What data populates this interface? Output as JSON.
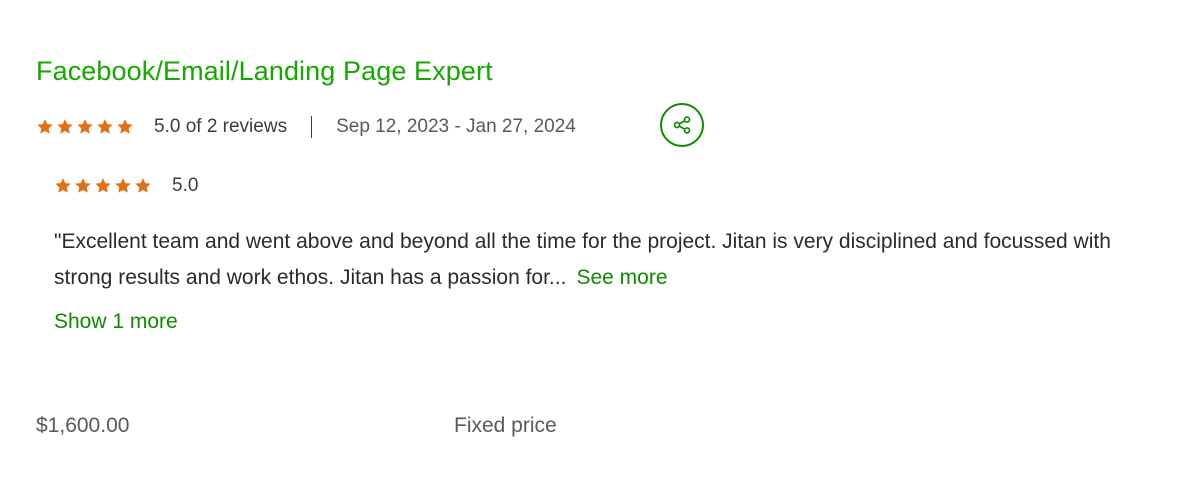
{
  "job": {
    "title": "Facebook/Email/Landing Page Expert",
    "overall_rating_text": "5.0 of 2 reviews",
    "star_count": 5,
    "date_range": "Sep 12, 2023 - Jan 27, 2024",
    "share_icon": "share-icon"
  },
  "review": {
    "score": "5.0",
    "star_count": 5,
    "text": "\"Excellent team and went above and beyond all the time for the project. Jitan is very disciplined and focussed with strong results and work ethos. Jitan has a passion for...",
    "see_more_label": "See more",
    "show_more_label": "Show 1 more"
  },
  "pricing": {
    "amount": "$1,600.00",
    "type": "Fixed price"
  },
  "colors": {
    "accent_green": "#14a800",
    "link_green": "#108a00",
    "star_orange": "#e36f13",
    "text_gray": "#5a5a5a"
  }
}
